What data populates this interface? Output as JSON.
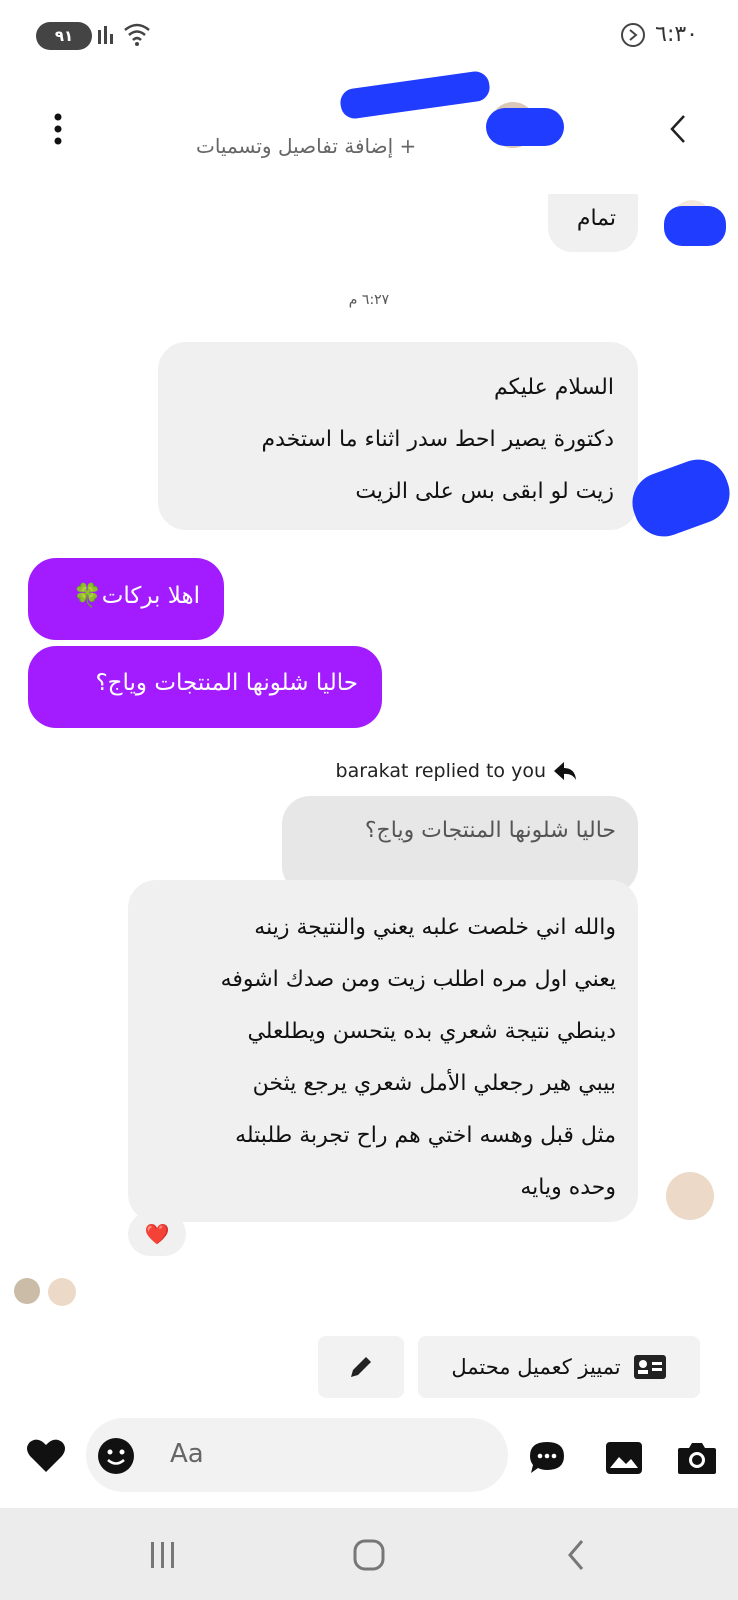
{
  "status_bar": {
    "time": "٦:٣٠",
    "battery": "٩١"
  },
  "header": {
    "subtitle": "+ إضافة تفاصيل وتسميات"
  },
  "messages": {
    "top_incoming": "تمام",
    "time_separator": "٦:٢٧ م",
    "incoming_1": [
      "السلام عليكم",
      "دكتورة يصير احط سدر اثناء ما استخدم",
      "زيت لو ابقى بس على الزيت"
    ],
    "outgoing_1": "اهلا بركات🍀",
    "outgoing_2": "حاليا شلونها المنتجات وياج؟",
    "reply_note": "barakat replied to you",
    "quoted": "حاليا شلونها المنتجات وياج؟",
    "incoming_2": [
      "والله اني خلصت علبه يعني والنتيجة زينه",
      "يعني اول مره اطلب زيت ومن صدك اشوفه",
      "دينطي نتيجة شعري بده يتحسن ويطلعلي",
      "بيبي هير رجعلي الأمل شعري يرجع يثخن",
      "مثل قبل وهسه اختي هم راح تجربة طلبتله",
      "وحده ويايه"
    ],
    "reaction": "❤️"
  },
  "actions": {
    "mark_customer": "تمييز كعميل محتمل"
  },
  "composer": {
    "placeholder": "Aa"
  },
  "colors": {
    "outgoing": "#a21cff",
    "incoming": "#f0f0f0",
    "redaction": "#1f3cff"
  },
  "icons": [
    "camera-icon",
    "gallery-icon",
    "chat-icon",
    "emoji-icon",
    "heart-icon",
    "pencil-icon",
    "contact-card-icon",
    "reply-arrow-icon"
  ]
}
